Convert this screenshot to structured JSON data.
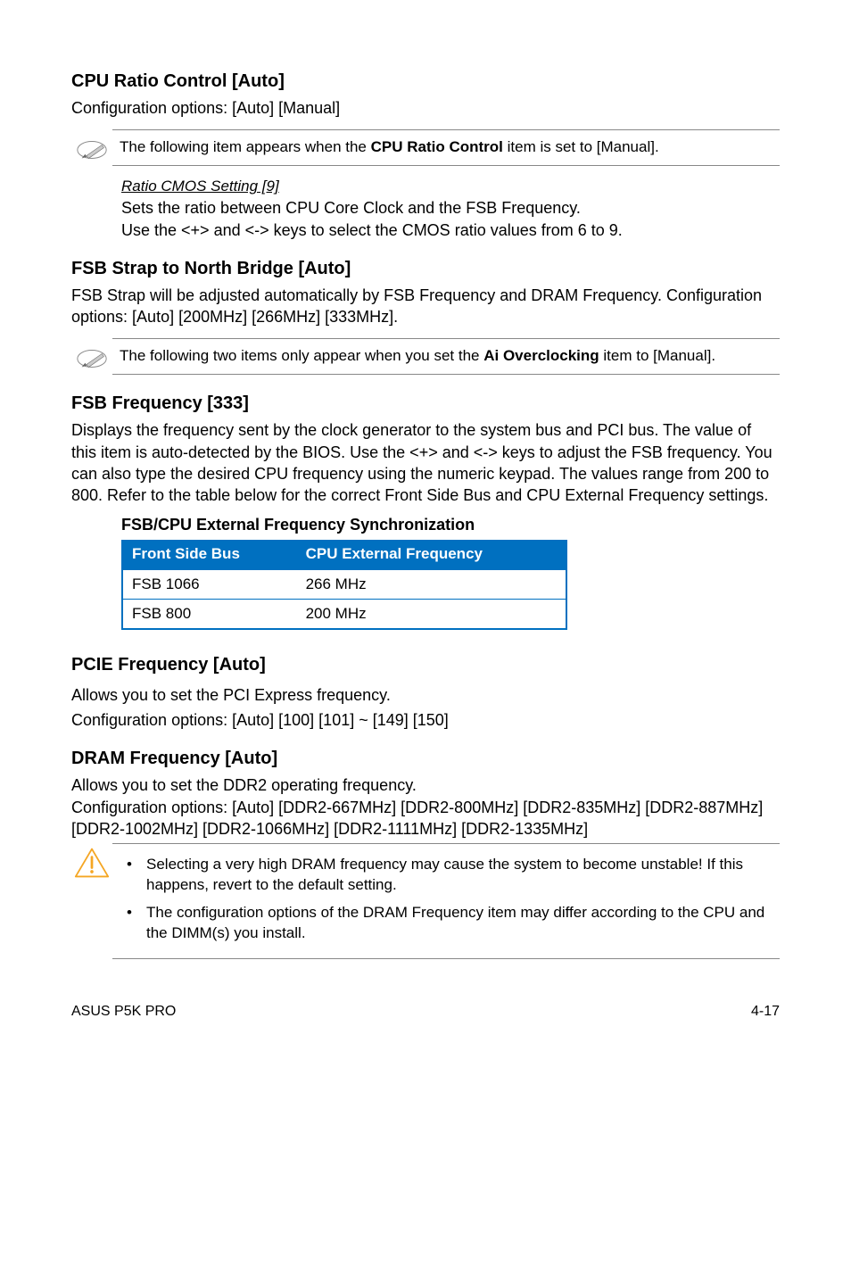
{
  "sections": {
    "cpu_ratio": {
      "title": "CPU Ratio Control [Auto]",
      "body": "Configuration options: [Auto] [Manual]",
      "note_prefix": "The following item appears when the ",
      "note_bold": "CPU Ratio Control",
      "note_suffix": " item is set to [Manual].",
      "sub_heading": "Ratio CMOS Setting [9]",
      "sub_line1": "Sets the ratio between CPU Core Clock and the FSB Frequency.",
      "sub_line2": "Use the <+> and <-> keys to select the CMOS ratio values from 6 to 9."
    },
    "fsb_strap": {
      "title": "FSB Strap to North Bridge [Auto]",
      "body": "FSB Strap will be adjusted automatically by FSB Frequency and DRAM Frequency. Configuration options: [Auto] [200MHz] [266MHz] [333MHz].",
      "note_prefix": "The following two items only appear when you set the ",
      "note_bold": "Ai Overclocking",
      "note_suffix": " item to [Manual]."
    },
    "fsb_freq": {
      "title": "FSB Frequency [333]",
      "body": "Displays the frequency sent by the clock generator to the system bus and PCI bus. The value of this item is auto-detected by the BIOS. Use the <+> and <-> keys to adjust the FSB frequency. You can also type the desired CPU frequency using the numeric keypad. The values range from 200 to 800. Refer to the table below for the correct Front Side Bus and CPU External Frequency settings.",
      "table_title": "FSB/CPU External Frequency Synchronization",
      "table": {
        "headers": [
          "Front Side Bus",
          "CPU External Frequency"
        ],
        "rows": [
          [
            "FSB 1066",
            "266 MHz"
          ],
          [
            "FSB 800",
            "200 MHz"
          ]
        ]
      }
    },
    "pcie": {
      "title": "PCIE Frequency [Auto]",
      "line1": "Allows you to set the PCI Express frequency.",
      "line2": "Configuration options: [Auto] [100] [101] ~ [149] [150]"
    },
    "dram": {
      "title": "DRAM Frequency [Auto]",
      "body": "Allows you to set the DDR2 operating frequency.\nConfiguration options: [Auto] [DDR2-667MHz] [DDR2-800MHz] [DDR2-835MHz] [DDR2-887MHz] [DDR2-1002MHz] [DDR2-1066MHz] [DDR2-1111MHz] [DDR2-1335MHz]",
      "warn1": "Selecting a very high DRAM frequency may cause the system to become unstable! If this happens, revert to the default setting.",
      "warn2": "The configuration options of the DRAM Frequency item may differ according to the CPU and the DIMM(s) you install."
    }
  },
  "footer": {
    "left": "ASUS P5K PRO",
    "right": "4-17"
  }
}
